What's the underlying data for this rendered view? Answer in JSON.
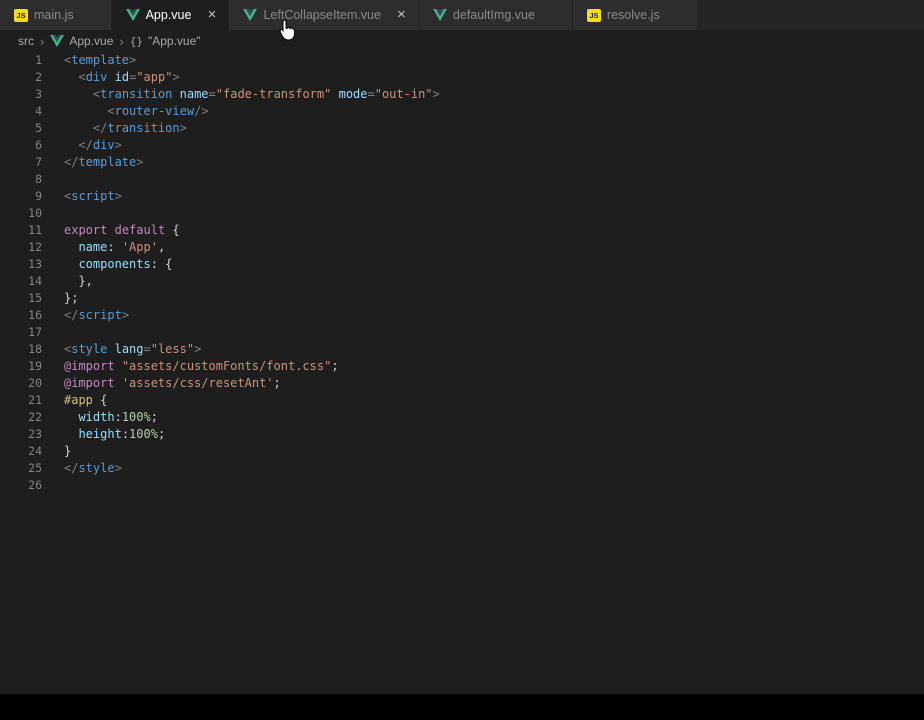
{
  "icons": {
    "chevron": "›",
    "close": "×",
    "js_label": "JS",
    "braces": "{}"
  },
  "colors": {
    "background": "#1e1e1e",
    "tab_bar": "#252526",
    "tab_inactive": "#2d2d2d",
    "vue_green": "#41b883",
    "vue_navy": "#34495e",
    "js_yellow": "#f5de19",
    "tag": "#569cd6",
    "attr": "#9cdcfe",
    "string": "#ce9178",
    "keyword": "#c586c0",
    "number": "#b5cea8",
    "selector": "#d7ba7d",
    "punct": "#808080",
    "text": "#d4d4d4",
    "line_number": "#858585"
  },
  "tab_bar": {
    "tabs": [
      {
        "label": "main.js",
        "icon": "js",
        "active": false,
        "show_close": false
      },
      {
        "label": "App.vue",
        "icon": "vue",
        "active": true,
        "show_close": true
      },
      {
        "label": "LeftCollapseItem.vue",
        "icon": "vue",
        "active": false,
        "show_close": true
      },
      {
        "label": "defaultImg.vue",
        "icon": "vue",
        "active": false,
        "show_close": false
      },
      {
        "label": "resolve.js",
        "icon": "js",
        "active": false,
        "show_close": false
      }
    ]
  },
  "breadcrumb": {
    "src": "src",
    "file": "App.vue",
    "symbol": "\"App.vue\""
  },
  "editor": {
    "lines": [
      {
        "num": "1",
        "tokens": [
          [
            "p",
            "<"
          ],
          [
            "t",
            "template"
          ],
          [
            "p",
            ">"
          ]
        ]
      },
      {
        "num": "2",
        "tokens": [
          [
            "d",
            "  "
          ],
          [
            "p",
            "<"
          ],
          [
            "t",
            "div"
          ],
          [
            "d",
            " "
          ],
          [
            "a",
            "id"
          ],
          [
            "p",
            "="
          ],
          [
            "s",
            "\"app\""
          ],
          [
            "p",
            ">"
          ]
        ]
      },
      {
        "num": "3",
        "tokens": [
          [
            "d",
            "    "
          ],
          [
            "p",
            "<"
          ],
          [
            "t",
            "transition"
          ],
          [
            "d",
            " "
          ],
          [
            "a",
            "name"
          ],
          [
            "p",
            "="
          ],
          [
            "s",
            "\"fade-transform\""
          ],
          [
            "d",
            " "
          ],
          [
            "a",
            "mode"
          ],
          [
            "p",
            "="
          ],
          [
            "s",
            "\"out-in\""
          ],
          [
            "p",
            ">"
          ]
        ]
      },
      {
        "num": "4",
        "tokens": [
          [
            "d",
            "      "
          ],
          [
            "p",
            "<"
          ],
          [
            "t",
            "router-view"
          ],
          [
            "p",
            "/>"
          ]
        ]
      },
      {
        "num": "5",
        "tokens": [
          [
            "d",
            "    "
          ],
          [
            "p",
            "</"
          ],
          [
            "t",
            "transition"
          ],
          [
            "p",
            ">"
          ]
        ]
      },
      {
        "num": "6",
        "tokens": [
          [
            "d",
            "  "
          ],
          [
            "p",
            "</"
          ],
          [
            "t",
            "div"
          ],
          [
            "p",
            ">"
          ]
        ]
      },
      {
        "num": "7",
        "tokens": [
          [
            "p",
            "</"
          ],
          [
            "t",
            "template"
          ],
          [
            "p",
            ">"
          ]
        ]
      },
      {
        "num": "8",
        "tokens": []
      },
      {
        "num": "9",
        "tokens": [
          [
            "p",
            "<"
          ],
          [
            "t",
            "script"
          ],
          [
            "p",
            ">"
          ]
        ]
      },
      {
        "num": "10",
        "tokens": []
      },
      {
        "num": "11",
        "tokens": [
          [
            "k",
            "export"
          ],
          [
            "d",
            " "
          ],
          [
            "k",
            "default"
          ],
          [
            "d",
            " {"
          ]
        ]
      },
      {
        "num": "12",
        "tokens": [
          [
            "d",
            "  "
          ],
          [
            "a",
            "name"
          ],
          [
            "d",
            ": "
          ],
          [
            "s",
            "'App'"
          ],
          [
            "d",
            ","
          ]
        ]
      },
      {
        "num": "13",
        "tokens": [
          [
            "d",
            "  "
          ],
          [
            "a",
            "components"
          ],
          [
            "d",
            ": {"
          ]
        ]
      },
      {
        "num": "14",
        "tokens": [
          [
            "d",
            "  },"
          ]
        ]
      },
      {
        "num": "15",
        "tokens": [
          [
            "d",
            "};"
          ]
        ]
      },
      {
        "num": "16",
        "tokens": [
          [
            "p",
            "</"
          ],
          [
            "t",
            "script"
          ],
          [
            "p",
            ">"
          ]
        ]
      },
      {
        "num": "17",
        "tokens": []
      },
      {
        "num": "18",
        "tokens": [
          [
            "p",
            "<"
          ],
          [
            "t",
            "style"
          ],
          [
            "d",
            " "
          ],
          [
            "a",
            "lang"
          ],
          [
            "p",
            "="
          ],
          [
            "s",
            "\"less\""
          ],
          [
            "p",
            ">"
          ]
        ]
      },
      {
        "num": "19",
        "tokens": [
          [
            "k",
            "@import"
          ],
          [
            "d",
            " "
          ],
          [
            "s",
            "\"assets/customFonts/font.css\""
          ],
          [
            "d",
            ";"
          ]
        ]
      },
      {
        "num": "20",
        "tokens": [
          [
            "k",
            "@import"
          ],
          [
            "d",
            " "
          ],
          [
            "s",
            "'assets/css/resetAnt'"
          ],
          [
            "d",
            ";"
          ]
        ]
      },
      {
        "num": "21",
        "tokens": [
          [
            "sel",
            "#app"
          ],
          [
            "d",
            " {"
          ]
        ]
      },
      {
        "num": "22",
        "tokens": [
          [
            "d",
            "  "
          ],
          [
            "a",
            "width"
          ],
          [
            "d",
            ":"
          ],
          [
            "n",
            "100%"
          ],
          [
            "d",
            ";"
          ]
        ]
      },
      {
        "num": "23",
        "tokens": [
          [
            "d",
            "  "
          ],
          [
            "a",
            "height"
          ],
          [
            "d",
            ":"
          ],
          [
            "n",
            "100%"
          ],
          [
            "d",
            ";"
          ]
        ]
      },
      {
        "num": "24",
        "tokens": [
          [
            "d",
            "}"
          ]
        ]
      },
      {
        "num": "25",
        "tokens": [
          [
            "p",
            "</"
          ],
          [
            "t",
            "style"
          ],
          [
            "p",
            ">"
          ]
        ]
      },
      {
        "num": "26",
        "tokens": []
      }
    ]
  }
}
